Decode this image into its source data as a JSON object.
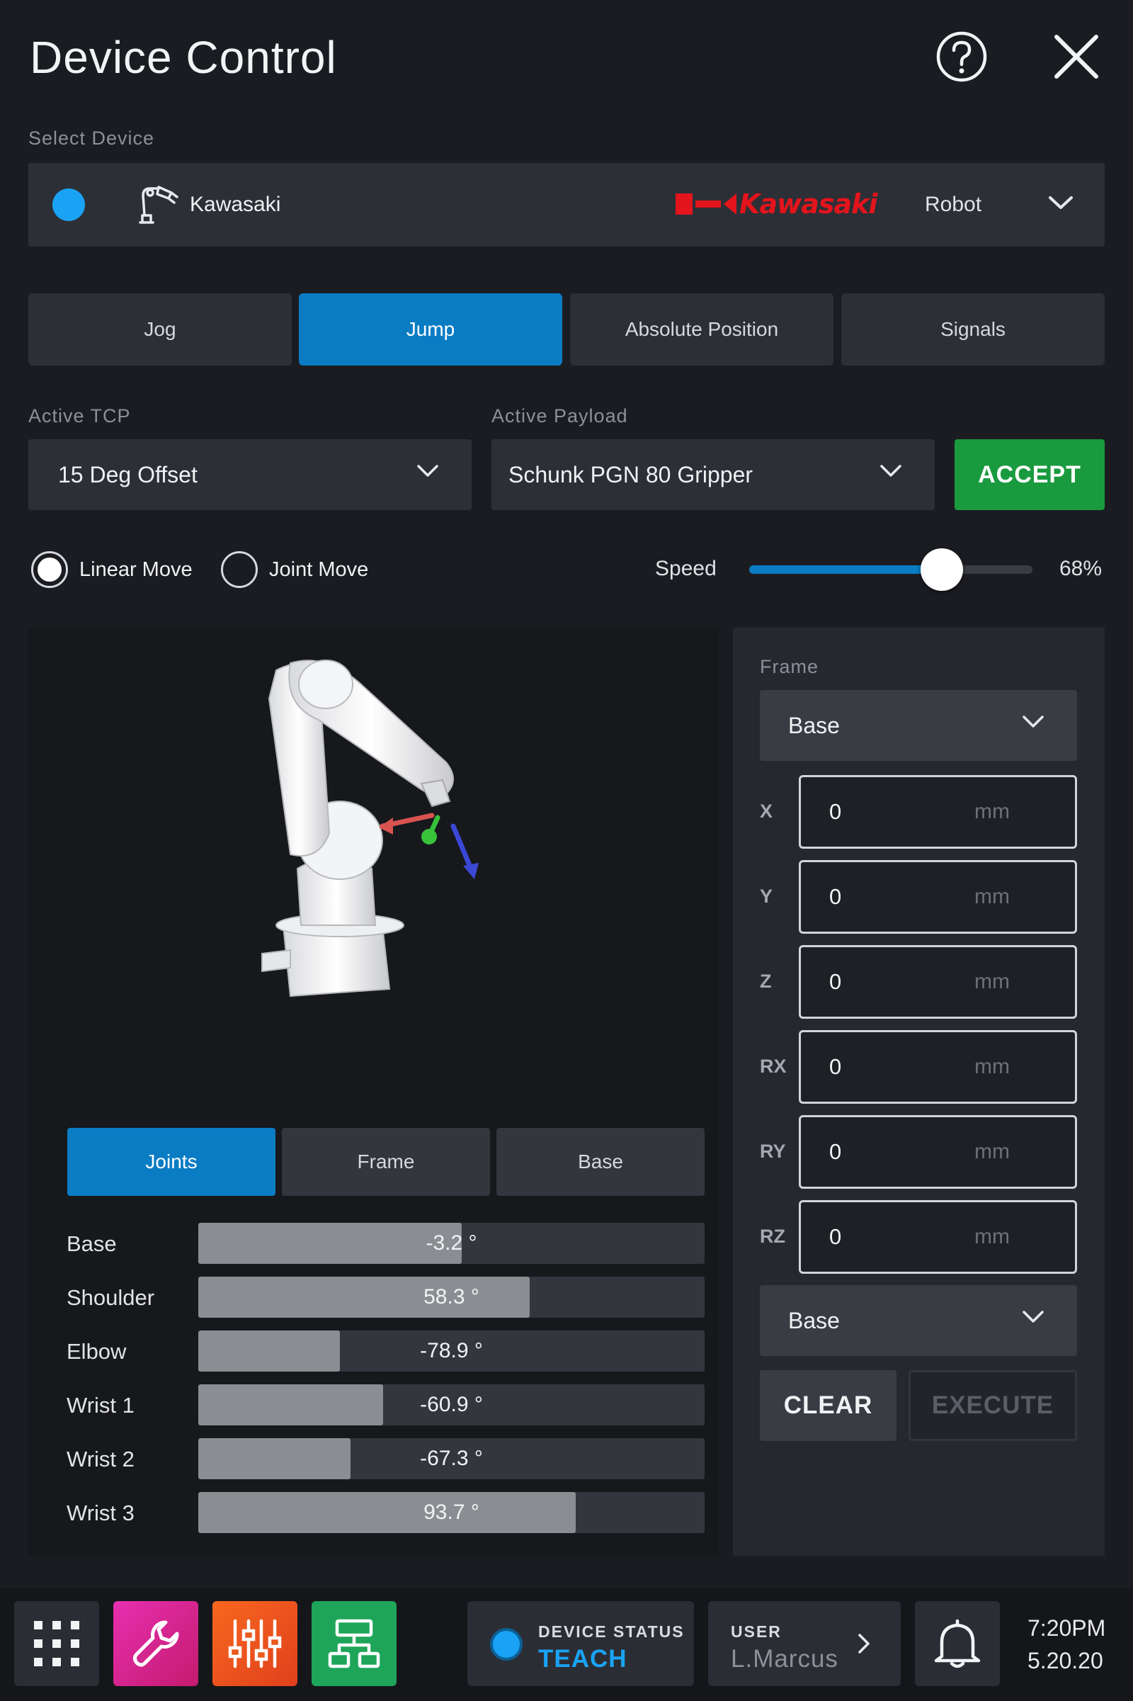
{
  "header": {
    "title": "Device Control"
  },
  "device": {
    "section_label": "Select Device",
    "name": "Kawasaki",
    "brand_logo": "Kawasaki",
    "type": "Robot",
    "status_color": "#1aa3f5"
  },
  "tabs": [
    {
      "label": "Jog"
    },
    {
      "label": "Jump"
    },
    {
      "label": "Absolute Position"
    },
    {
      "label": "Signals"
    }
  ],
  "active_tab": "Jump",
  "tcp": {
    "label": "Active TCP",
    "value": "15 Deg Offset"
  },
  "payload": {
    "label": "Active Payload",
    "value": "Schunk PGN 80 Gripper"
  },
  "accept_label": "ACCEPT",
  "move_modes": [
    {
      "label": "Linear Move",
      "selected": true
    },
    {
      "label": "Joint Move",
      "selected": false
    }
  ],
  "speed": {
    "label": "Speed",
    "value": 68,
    "display": "68%"
  },
  "subtabs": [
    {
      "label": "Joints"
    },
    {
      "label": "Frame"
    },
    {
      "label": "Base"
    }
  ],
  "joints": [
    {
      "name": "Base",
      "display": "-3.2 °",
      "fill": 0.52
    },
    {
      "name": "Shoulder",
      "display": "58.3 °",
      "fill": 0.655
    },
    {
      "name": "Elbow",
      "display": "-78.9 °",
      "fill": 0.28
    },
    {
      "name": "Wrist 1",
      "display": "-60.9 °",
      "fill": 0.365
    },
    {
      "name": "Wrist 2",
      "display": "-67.3 °",
      "fill": 0.3
    },
    {
      "name": "Wrist 3",
      "display": "93.7 °",
      "fill": 0.745
    }
  ],
  "frame_panel": {
    "label": "Frame",
    "frame_select": "Base",
    "axes": [
      {
        "name": "X",
        "value": "0",
        "unit": "mm"
      },
      {
        "name": "Y",
        "value": "0",
        "unit": "mm"
      },
      {
        "name": "Z",
        "value": "0",
        "unit": "mm"
      },
      {
        "name": "RX",
        "value": "0",
        "unit": "mm"
      },
      {
        "name": "RY",
        "value": "0",
        "unit": "mm"
      },
      {
        "name": "RZ",
        "value": "0",
        "unit": "mm"
      }
    ],
    "reference_select": "Base",
    "clear_label": "CLEAR",
    "execute_label": "EXECUTE"
  },
  "bottom_bar": {
    "apps": [
      {
        "icon": "grid-icon",
        "color": "#2b2d34"
      },
      {
        "icon": "wrench-icon",
        "color": "#d6248c"
      },
      {
        "icon": "sliders-icon",
        "color": "#f0561d"
      },
      {
        "icon": "network-icon",
        "color": "#1ea55a"
      }
    ],
    "device_status": {
      "label": "DEVICE STATUS",
      "value": "TEACH",
      "color": "#1aa3f5"
    },
    "user": {
      "label": "USER",
      "value": "L.Marcus"
    },
    "time": "7:20PM",
    "date": "5.20.20"
  }
}
